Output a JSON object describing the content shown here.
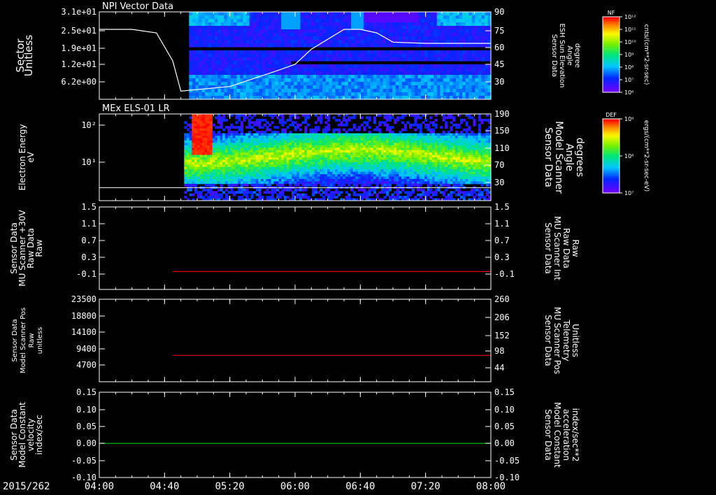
{
  "date_label": "2015/262",
  "x_ticks": [
    "04:00",
    "04:40",
    "05:20",
    "06:00",
    "06:40",
    "07:20",
    "08:00"
  ],
  "panel1": {
    "title": "NPI Vector Data",
    "ylabel": [
      "Sector",
      "Unitless"
    ],
    "yticks": [
      "3.1e+01",
      "2.5e+01",
      "1.9e+01",
      "1.2e+01",
      "6.2e+00"
    ],
    "right_ticks": [
      "90",
      "75",
      "60",
      "45",
      "30"
    ],
    "right_label": [
      "Sensor Data",
      "ESH Sun Elevation",
      "Angle",
      "degree"
    ],
    "colorbar_title": "NF",
    "colorbar_ticks": [
      "10¹²",
      "10¹¹",
      "10¹⁰",
      "10⁹",
      "10⁸",
      "10⁷",
      "10⁶"
    ],
    "colorbar_units": "cnts/(cm**2-sr-sec)"
  },
  "panel2": {
    "title": "MEx ELS-01 LR",
    "ylabel": [
      "Electron Energy",
      "eV"
    ],
    "yticks": [
      "10²",
      "10¹"
    ],
    "right_ticks": [
      "190",
      "150",
      "110",
      "70",
      "30"
    ],
    "right_label": [
      "Sensor Data",
      "Model Scanner",
      "Angle",
      "degrees"
    ],
    "colorbar_title": "DEF",
    "colorbar_ticks": [
      "10⁹",
      "10⁸",
      "10⁷"
    ],
    "colorbar_units": "ergs/(cm**2-sr-sec-eV)"
  },
  "panel3": {
    "ylabel": [
      "Sensor Data",
      "MU Scanner +30V",
      "Raw Data",
      "Raw"
    ],
    "yticks": [
      "1.5",
      "1.1",
      "0.7",
      "0.3",
      "-0.1"
    ],
    "right_ticks": [
      "1.5",
      "1.1",
      "0.7",
      "0.3",
      "-0.1"
    ],
    "right_label": [
      "Sensor Data",
      "MU Scanner Int",
      "Raw Data",
      "Raw"
    ]
  },
  "panel4": {
    "ylabel": [
      "Sensor Data",
      "Model Scanner Pos",
      "Raw",
      "unitless"
    ],
    "yticks": [
      "23500",
      "18800",
      "14100",
      "9400",
      "4700"
    ],
    "right_ticks": [
      "260",
      "206",
      "152",
      "98",
      "44"
    ],
    "right_label": [
      "Sensor Data",
      "MU Scanner Pos",
      "Telemetry",
      "Unitless"
    ]
  },
  "panel5": {
    "ylabel": [
      "Sensor Data",
      "Model Constant",
      "velocity",
      "index/sec"
    ],
    "yticks": [
      "0.15",
      "0.10",
      "0.05",
      "0.00",
      "-0.05",
      "-0.10"
    ],
    "right_ticks": [
      "0.15",
      "0.10",
      "0.05",
      "0.00",
      "-0.05",
      "-0.10"
    ],
    "right_label": [
      "Sensor Data",
      "Model Constant",
      "acceleration",
      "index/sec**2"
    ]
  },
  "colors": {
    "red_series": "#e00000",
    "green_series": "#00d000",
    "white_series": "#ffffff"
  },
  "chart_data": [
    {
      "type": "heatmap",
      "title": "NPI Vector Data",
      "ylabel": "Sector Unitless",
      "x_range": [
        "04:00",
        "08:00"
      ],
      "y_range": [
        0,
        31
      ],
      "data_start": "04:55",
      "series": [
        {
          "name": "ESH Sun Elevation Angle",
          "axis": "right",
          "x": [
            "04:00",
            "04:20",
            "04:35",
            "04:45",
            "04:50",
            "05:20",
            "05:50",
            "06:00",
            "06:10",
            "06:30",
            "06:40",
            "06:50",
            "07:00",
            "07:20",
            "08:00"
          ],
          "y": [
            75,
            75,
            72,
            48,
            22,
            26,
            40,
            45,
            58,
            75,
            75,
            72,
            64,
            63,
            63
          ]
        }
      ]
    },
    {
      "type": "heatmap",
      "title": "MEx ELS-01 LR",
      "ylabel": "Electron Energy eV",
      "x_range": [
        "04:00",
        "08:00"
      ],
      "data_start": "04:52",
      "peak_interval": [
        "04:57",
        "05:09"
      ],
      "series": [
        {
          "name": "Model Scanner Angle",
          "axis": "right",
          "x": [
            "04:00",
            "08:00"
          ],
          "y": [
            18,
            18
          ]
        }
      ]
    },
    {
      "type": "line",
      "x_range": [
        "04:00",
        "08:00"
      ],
      "ylim": [
        -0.3,
        1.5
      ],
      "series": [
        {
          "name": "MU Scanner Int Raw Data",
          "axis": "right",
          "x": [
            "04:45",
            "08:00"
          ],
          "y": [
            -0.04,
            -0.04
          ]
        }
      ]
    },
    {
      "type": "line",
      "x_range": [
        "04:00",
        "08:00"
      ],
      "ylim": [
        0,
        23500
      ],
      "series": [
        {
          "name": "MU Scanner Pos Telemetry",
          "axis": "right",
          "x": [
            "04:45",
            "08:00"
          ],
          "y": [
            83,
            83
          ]
        }
      ]
    },
    {
      "type": "line",
      "x_range": [
        "04:00",
        "08:00"
      ],
      "ylim": [
        -0.1,
        0.15
      ],
      "series": [
        {
          "name": "Model Constant acceleration",
          "axis": "right",
          "x": [
            "04:00",
            "08:00"
          ],
          "y": [
            0.0,
            0.0
          ]
        }
      ]
    }
  ]
}
